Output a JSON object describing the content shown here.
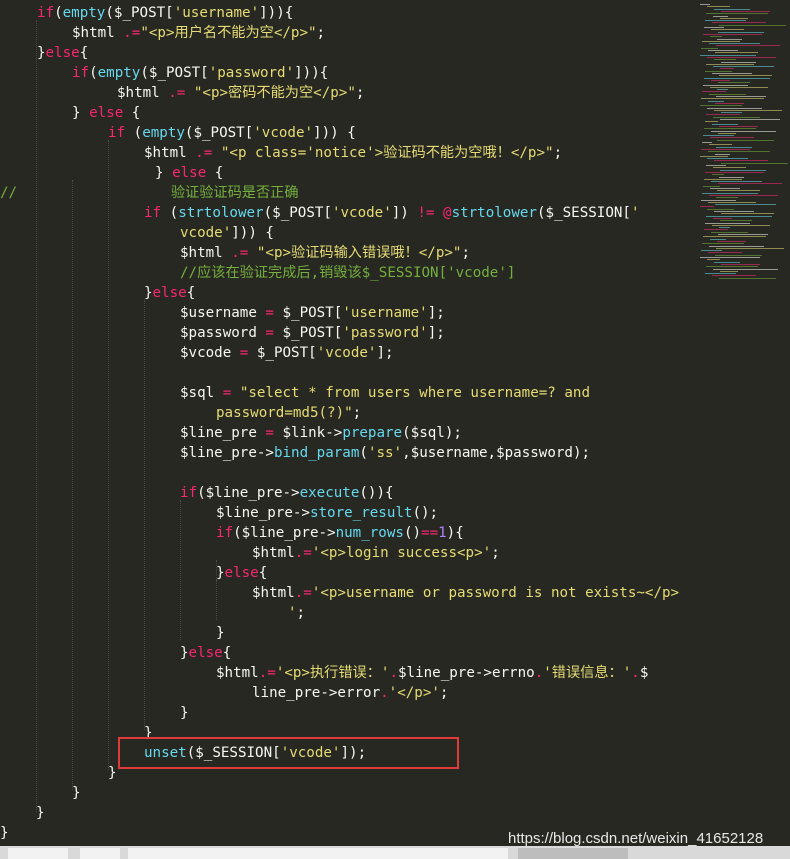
{
  "colors": {
    "background": "#272822",
    "default": "#f8f8f2",
    "keyword": "#f92672",
    "function": "#66d9ef",
    "string": "#e6db74",
    "number": "#ae81ff",
    "comment": "#75af3e",
    "highlight_box": "#e03b3b"
  },
  "code_lines": [
    [
      [
        "if",
        "keyword"
      ],
      [
        "(",
        "default"
      ],
      [
        "empty",
        "function"
      ],
      [
        "($_POST[",
        "default"
      ],
      [
        "'username'",
        "string"
      ],
      [
        "])){",
        "default"
      ]
    ],
    [
      [
        "$html ",
        "default"
      ],
      [
        ".=",
        "keyword"
      ],
      [
        "\"<p>用户名不能为空</p>\"",
        "string"
      ],
      [
        ";",
        "default"
      ]
    ],
    [
      [
        "}",
        "default"
      ],
      [
        "else",
        "keyword"
      ],
      [
        "{",
        "default"
      ]
    ],
    [
      [
        "if",
        "keyword"
      ],
      [
        "(",
        "default"
      ],
      [
        "empty",
        "function"
      ],
      [
        "($_POST[",
        "default"
      ],
      [
        "'password'",
        "string"
      ],
      [
        "])){",
        "default"
      ]
    ],
    [
      [
        "$html ",
        "default"
      ],
      [
        ".= ",
        "keyword"
      ],
      [
        "\"<p>密码不能为空</p>\"",
        "string"
      ],
      [
        ";",
        "default"
      ]
    ],
    [
      [
        "} ",
        "default"
      ],
      [
        "else",
        "keyword"
      ],
      [
        " {",
        "default"
      ]
    ],
    [
      [
        "if",
        "keyword"
      ],
      [
        " (",
        "default"
      ],
      [
        "empty",
        "function"
      ],
      [
        "($_POST[",
        "default"
      ],
      [
        "'vcode'",
        "string"
      ],
      [
        "])) {",
        "default"
      ]
    ],
    [
      [
        "$html ",
        "default"
      ],
      [
        ".= ",
        "keyword"
      ],
      [
        "\"<p class='notice'>验证码不能为空哦！</p>\"",
        "string"
      ],
      [
        ";",
        "default"
      ]
    ],
    [
      [
        "} ",
        "default"
      ],
      [
        "else",
        "keyword"
      ],
      [
        " {",
        "default"
      ]
    ],
    [
      [
        "//                  验证验证码是否正确",
        "comment"
      ]
    ],
    [
      [
        "if",
        "keyword"
      ],
      [
        " (",
        "default"
      ],
      [
        "strtolower",
        "function"
      ],
      [
        "($_POST[",
        "default"
      ],
      [
        "'vcode'",
        "string"
      ],
      [
        "]) ",
        "default"
      ],
      [
        "!=",
        "keyword"
      ],
      [
        " ",
        "default"
      ],
      [
        "@",
        "keyword"
      ],
      [
        "strtolower",
        "function"
      ],
      [
        "($_SESSION[",
        "default"
      ],
      [
        "'",
        "string"
      ]
    ],
    [
      [
        "vcode'",
        "string"
      ],
      [
        "])) {",
        "default"
      ]
    ],
    [
      [
        "$html ",
        "default"
      ],
      [
        ".= ",
        "keyword"
      ],
      [
        "\"<p>验证码输入错误哦！</p>\"",
        "string"
      ],
      [
        ";",
        "default"
      ]
    ],
    [
      [
        "//应该在验证完成后,销毁该$_SESSION['vcode']",
        "comment"
      ]
    ],
    [
      [
        "}",
        "default"
      ],
      [
        "else",
        "keyword"
      ],
      [
        "{",
        "default"
      ]
    ],
    [
      [
        "$username ",
        "default"
      ],
      [
        "=",
        "keyword"
      ],
      [
        " $_POST[",
        "default"
      ],
      [
        "'username'",
        "string"
      ],
      [
        "];",
        "default"
      ]
    ],
    [
      [
        "$password ",
        "default"
      ],
      [
        "=",
        "keyword"
      ],
      [
        " $_POST[",
        "default"
      ],
      [
        "'password'",
        "string"
      ],
      [
        "];",
        "default"
      ]
    ],
    [
      [
        "$vcode ",
        "default"
      ],
      [
        "=",
        "keyword"
      ],
      [
        " $_POST[",
        "default"
      ],
      [
        "'vcode'",
        "string"
      ],
      [
        "];",
        "default"
      ]
    ],
    [],
    [
      [
        "$sql ",
        "default"
      ],
      [
        "=",
        "keyword"
      ],
      [
        " ",
        "default"
      ],
      [
        "\"select * from users where username=? and",
        "string"
      ]
    ],
    [
      [
        "password=md5(?)\"",
        "string"
      ],
      [
        ";",
        "default"
      ]
    ],
    [
      [
        "$line_pre ",
        "default"
      ],
      [
        "=",
        "keyword"
      ],
      [
        " $link->",
        "default"
      ],
      [
        "prepare",
        "function"
      ],
      [
        "($sql);",
        "default"
      ]
    ],
    [
      [
        "$line_pre->",
        "default"
      ],
      [
        "bind_param",
        "function"
      ],
      [
        "(",
        "default"
      ],
      [
        "'ss'",
        "string"
      ],
      [
        ",$username,$password);",
        "default"
      ]
    ],
    [],
    [
      [
        "if",
        "keyword"
      ],
      [
        "($line_pre->",
        "default"
      ],
      [
        "execute",
        "function"
      ],
      [
        "()){",
        "default"
      ]
    ],
    [
      [
        "$line_pre->",
        "default"
      ],
      [
        "store_result",
        "function"
      ],
      [
        "();",
        "default"
      ]
    ],
    [
      [
        "if",
        "keyword"
      ],
      [
        "($line_pre->",
        "default"
      ],
      [
        "num_rows",
        "function"
      ],
      [
        "()",
        "default"
      ],
      [
        "==",
        "keyword"
      ],
      [
        "1",
        "number"
      ],
      [
        "){",
        "default"
      ]
    ],
    [
      [
        "$html",
        ""
      ],
      [
        ".=",
        "keyword"
      ],
      [
        "'<p>login success<p>'",
        "string"
      ],
      [
        ";",
        "default"
      ]
    ],
    [
      [
        "}",
        "default"
      ],
      [
        "else",
        "keyword"
      ],
      [
        "{",
        "default"
      ]
    ],
    [
      [
        "$html",
        ""
      ],
      [
        ".=",
        "keyword"
      ],
      [
        "'<p>username or password is not exists~</p>",
        "string"
      ]
    ],
    [
      [
        "'",
        "string"
      ],
      [
        ";",
        "default"
      ]
    ],
    [
      [
        "}",
        "default"
      ]
    ],
    [
      [
        "}",
        "default"
      ],
      [
        "else",
        "keyword"
      ],
      [
        "{",
        "default"
      ]
    ],
    [
      [
        "$html",
        ""
      ],
      [
        ".=",
        "keyword"
      ],
      [
        "'<p>执行错误：'",
        "string"
      ],
      [
        ".",
        "keyword"
      ],
      [
        "$line_pre->errno",
        ""
      ],
      [
        ".",
        "keyword"
      ],
      [
        "'错误信息：'",
        "string"
      ],
      [
        ".",
        "keyword"
      ],
      [
        "$",
        "default"
      ]
    ],
    [
      [
        "line_pre->error",
        ""
      ],
      [
        ".",
        "keyword"
      ],
      [
        "'</p>'",
        "string"
      ],
      [
        ";",
        "default"
      ]
    ],
    [
      [
        "}",
        "default"
      ]
    ],
    [
      [
        "}",
        "default"
      ]
    ],
    [
      [
        "unset",
        "function"
      ],
      [
        "($_SESSION[",
        "default"
      ],
      [
        "'vcode'",
        "string"
      ],
      [
        "]);",
        "default"
      ]
    ],
    [
      [
        "}",
        "default"
      ]
    ],
    [
      [
        "}",
        "default"
      ]
    ],
    [
      [
        "}",
        "default"
      ]
    ],
    [
      [
        "}",
        "default"
      ]
    ]
  ],
  "watermark": "https://blog.csdn.net/weixin_41652128"
}
